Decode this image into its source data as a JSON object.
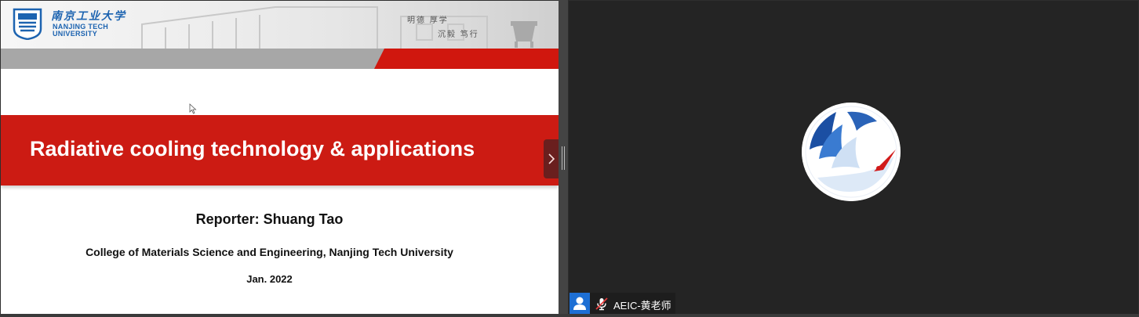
{
  "slide": {
    "university_cn": "南京工业大学",
    "university_en_line1": "NANJING TECH",
    "university_en_line2": "UNIVERSITY",
    "motto_line1": "明德 厚学",
    "motto_line2": "沉毅 笃行",
    "title": "Radiative cooling technology & applications",
    "reporter": "Reporter:  Shuang Tao",
    "college": "College of Materials Science and Engineering, Nanjing Tech University",
    "date": "Jan. 2022"
  },
  "video": {
    "participant_name": "AEIC-黄老师",
    "person_icon": "person-icon",
    "mic_icon": "mic-muted-icon"
  },
  "colors": {
    "slide_red": "#cc1b13",
    "university_blue": "#1c63b0",
    "video_bg": "#242424",
    "person_badge": "#1d6fd4"
  }
}
